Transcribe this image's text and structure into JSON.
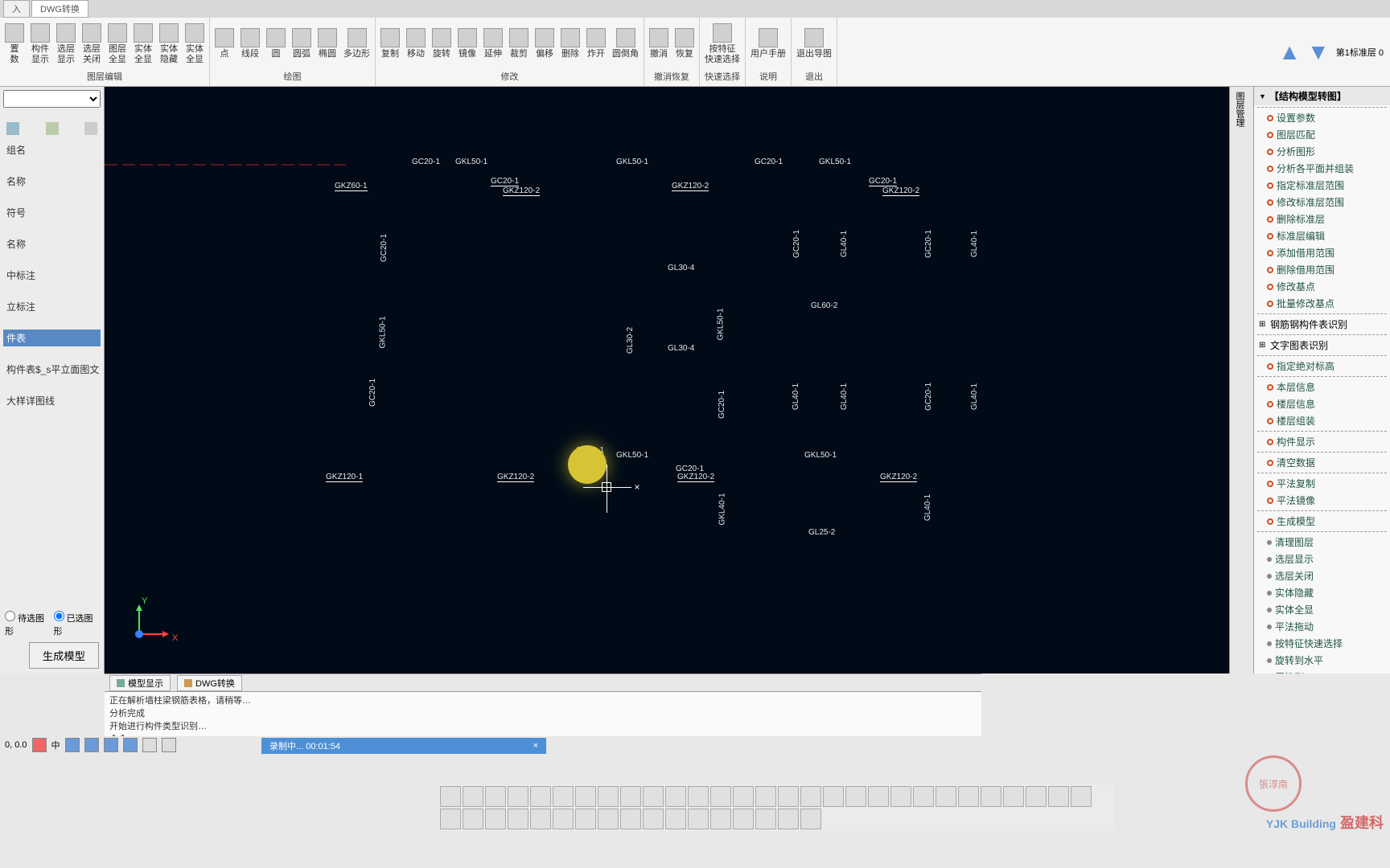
{
  "tabs": {
    "t1": "入",
    "t2": "DWG转换"
  },
  "ribbon": {
    "groups": [
      {
        "title": "图层编辑",
        "items": [
          "置\n数",
          "构件\n显示",
          "选层\n显示",
          "选层\n关闭",
          "图层\n全显",
          "实体\n全显",
          "实体\n隐藏",
          "实体\n全显"
        ]
      },
      {
        "title": "绘图",
        "items": [
          "点",
          "线段",
          "圆",
          "圆弧",
          "椭圆",
          "多边形"
        ]
      },
      {
        "title": "修改",
        "items": [
          "复制",
          "移动",
          "旋转",
          "镜像",
          "延伸",
          "裁剪",
          "偏移",
          "删除",
          "炸开",
          "圆倒角"
        ]
      },
      {
        "title": "撤消恢复",
        "items": [
          "撤消",
          "恢复"
        ]
      },
      {
        "title": "快速选择",
        "items": [
          "按特征\n快速选择"
        ]
      },
      {
        "title": "说明",
        "items": [
          "用户手册"
        ]
      },
      {
        "title": "退出",
        "items": [
          "退出导图"
        ]
      }
    ],
    "floor_label": "第1标准层 0"
  },
  "left": {
    "headers": [
      "组名",
      "名称",
      "符号",
      "名称",
      "中标注",
      "立标注",
      "件表",
      "构件表$_s平立面图文",
      "大样详图线"
    ],
    "selected": "件表",
    "radio1": "待选图形",
    "radio2": "已选图形",
    "gen": "生成模型",
    "coord": "0.0, 0.0"
  },
  "canvas": {
    "labels": {
      "GC20_1a": "GC20-1",
      "GKL50_1a": "GKL50-1",
      "GKL50_1b": "GKL50-1",
      "GC20_1b": "GC20-1",
      "GKL50_1c": "GKL50-1",
      "GKZ60_1": "GKZ60-1",
      "GC20_1c": "GC20-1",
      "GKZ120_2a": "GKZ120-2",
      "GKZ120_2b": "GKZ120-2",
      "GC20_1d": "GC20-1",
      "GKZ120_2c": "GKZ120-2",
      "GC20_1v1": "GC20-1",
      "GKL50_1v": "GKL50-1",
      "GL30_4a": "GL30-4",
      "GL30_4b": "GL30-4",
      "GL30_2": "GL30-2",
      "GC20_1v2": "GC20-1",
      "GKL50_1v2": "GKL50-1",
      "GC20_1v3": "GC20-1",
      "GL40_1a": "GL40-1",
      "GC20_1v4": "GC20-1",
      "GL40_1b": "GL40-1",
      "GL60_2": "GL60-2",
      "GL40_1c": "GL40-1",
      "GL40_1d": "GL40-1",
      "GC20_1v5": "GC20-1",
      "GL40_1e": "GL40-1",
      "GKZ120_1": "GKZ120-1",
      "GKZ120_2d": "GKZ120-2",
      "GKZ120_2e": "GKZ120-2",
      "GKZ120_2f": "GKZ120-2",
      "GC20_1m": "GC20-1",
      "GKL50_1m": "GKL50-1",
      "GC20_1m2": "GC20-1",
      "GKL50_1m2": "GKL50-1",
      "GKL40_1": "GKL40-1",
      "GL25_2": "GL25-2",
      "GL40_1f": "GL40-1"
    },
    "y": "Y",
    "x": "X"
  },
  "btabs": {
    "t1": "模型显示",
    "t2": "DWG转换"
  },
  "log": {
    "l1": "正在解析墙柱梁钢筋表格，请稍等…",
    "l2": "分析完成",
    "l3": "开始进行构件类型识别…",
    "l4": "命令:"
  },
  "rpanel": {
    "header": "【结构模型转图】",
    "items1": [
      "设置参数",
      "图层匹配",
      "分析图形",
      "分析各平面并组装",
      "指定标准层范围",
      "修改标准层范围",
      "删除标准层",
      "标准层编辑",
      "添加借用范围",
      "删除借用范围",
      "修改基点",
      "批量修改基点"
    ],
    "sub1": "钢筋钢构件表识别",
    "sub2": "文字图表识别",
    "items2": [
      "指定绝对标高"
    ],
    "items3": [
      "本层信息",
      "楼层信息",
      "楼层组装"
    ],
    "items4": [
      "构件显示"
    ],
    "items5": [
      "清空数据"
    ],
    "items6": [
      "平法复制",
      "平法镜像"
    ],
    "items7": [
      "生成模型"
    ],
    "items8": [
      "清理图层",
      "选层显示",
      "选层关闭",
      "实体隐藏",
      "实体全显",
      "平法拖动",
      "按特征快速选择",
      "旋转到水平",
      "属性刷"
    ]
  },
  "status": {
    "left_coord": "0, 0.0",
    "rec": "录制中... 00:01:54"
  },
  "wm": {
    "brand": "盈建科",
    "stamp": "張淳南",
    "eng": "YJK Building"
  }
}
